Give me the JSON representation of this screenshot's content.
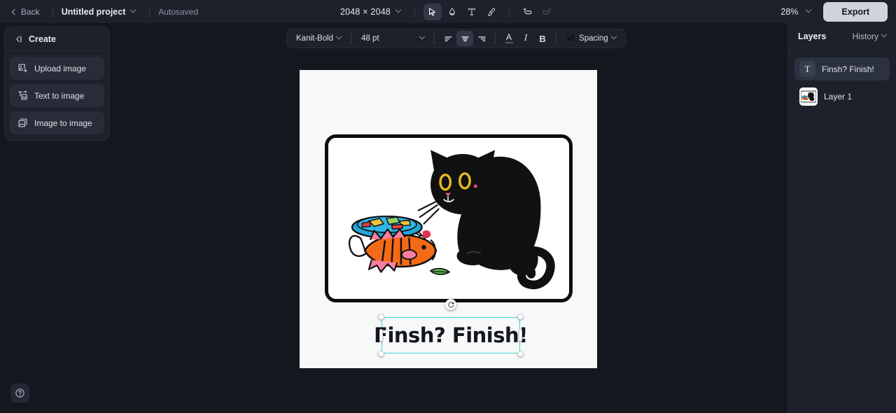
{
  "topbar": {
    "back_label": "Back",
    "project_name": "Untitled project",
    "autosaved_label": "Autosaved",
    "canvas_size": "2048 × 2048",
    "zoom_level": "28%",
    "export_label": "Export",
    "tools": [
      {
        "name": "select-tool",
        "icon": "cursor-icon",
        "active": true
      },
      {
        "name": "eraser-tool",
        "icon": "eraser-icon",
        "active": false
      },
      {
        "name": "text-tool",
        "icon": "text-icon",
        "active": false
      },
      {
        "name": "brush-tool",
        "icon": "brush-icon",
        "active": false
      }
    ],
    "undo_label": "Undo",
    "redo_label": "Redo"
  },
  "create_panel": {
    "title": "Create",
    "items": [
      {
        "label": "Upload image",
        "icon": "upload-image-icon"
      },
      {
        "label": "Text to image",
        "icon": "text-to-image-icon"
      },
      {
        "label": "Image to image",
        "icon": "image-to-image-icon"
      }
    ]
  },
  "text_toolbar": {
    "font_family": "Kanit-Bold",
    "font_size": "48 pt",
    "align_left_label": "Align left",
    "align_center_label": "Align center",
    "align_right_label": "Align right",
    "color_label": "A",
    "italic_label": "I",
    "bold_label": "B",
    "spacing_label": "Spacing"
  },
  "canvas": {
    "text_element": "Finsh? Finish!",
    "rotate_label": "Rotate"
  },
  "right_panel": {
    "title": "Layers",
    "history_label": "History",
    "layers": [
      {
        "name": "Finsh? Finish!",
        "type": "text",
        "selected": true
      },
      {
        "name": "Layer 1",
        "type": "image",
        "selected": false
      }
    ]
  },
  "help": {
    "label": "Help"
  },
  "colors": {
    "app_bg": "#14171e",
    "panel_bg": "#1d212b",
    "accent_selection": "#3ed6d6",
    "export_bg": "#ced3dc",
    "canvas_bg": "#f7f8f8",
    "cat_black": "#111111",
    "fish_orange": "#f56a16",
    "fish_pink": "#f77fa0",
    "plate_blue": "#22a5d8"
  }
}
